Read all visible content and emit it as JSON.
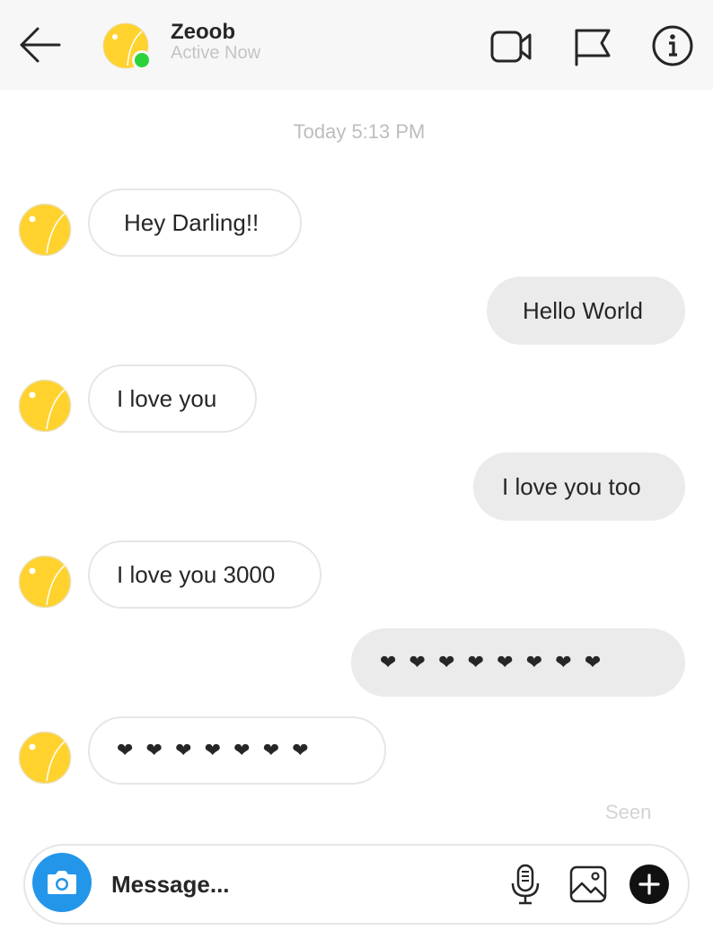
{
  "header": {
    "contact_name": "Zeoob",
    "status": "Active Now",
    "icons": {
      "back": "arrow-left-icon",
      "video": "video-camera-icon",
      "flag": "flag-icon",
      "info": "info-icon"
    }
  },
  "conversation": {
    "timestamp": "Today 5:13 PM",
    "messages": [
      {
        "direction": "incoming",
        "text": "Hey Darling!!"
      },
      {
        "direction": "outgoing",
        "text": "Hello World"
      },
      {
        "direction": "incoming",
        "text": "I love you"
      },
      {
        "direction": "outgoing",
        "text": "I love you too"
      },
      {
        "direction": "incoming",
        "text": "I love you 3000"
      },
      {
        "direction": "outgoing",
        "text": "❤ ❤ ❤ ❤ ❤ ❤ ❤ ❤"
      },
      {
        "direction": "incoming",
        "text": "❤ ❤ ❤ ❤ ❤ ❤ ❤"
      }
    ],
    "seen_label": "Seen"
  },
  "composer": {
    "placeholder": "Message...",
    "value": "",
    "icons": {
      "camera": "camera-icon",
      "mic": "microphone-icon",
      "gallery": "image-gallery-icon",
      "add": "plus-circle-icon"
    }
  },
  "colors": {
    "avatar": "#ffd22e",
    "online": "#2bd23c",
    "camera_button": "#2496ea",
    "outgoing_bubble": "#ebebeb",
    "header_bg": "#f7f7f7"
  }
}
